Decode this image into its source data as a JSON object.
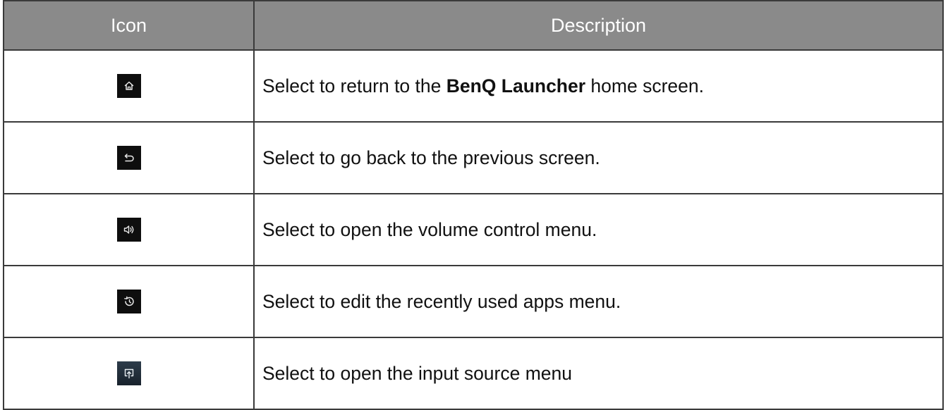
{
  "table": {
    "headers": {
      "icon": "Icon",
      "description": "Description"
    },
    "rows": [
      {
        "icon": "home-icon",
        "before": "Select to return to the ",
        "bold": "BenQ Launcher",
        "after": " home screen."
      },
      {
        "icon": "back-icon",
        "text": "Select to go back to the previous screen."
      },
      {
        "icon": "volume-icon",
        "text": "Select to open the volume control menu."
      },
      {
        "icon": "recent-apps-icon",
        "text": "Select to edit the recently used apps menu."
      },
      {
        "icon": "input-source-icon",
        "text": "Select to open the input source menu"
      }
    ]
  }
}
